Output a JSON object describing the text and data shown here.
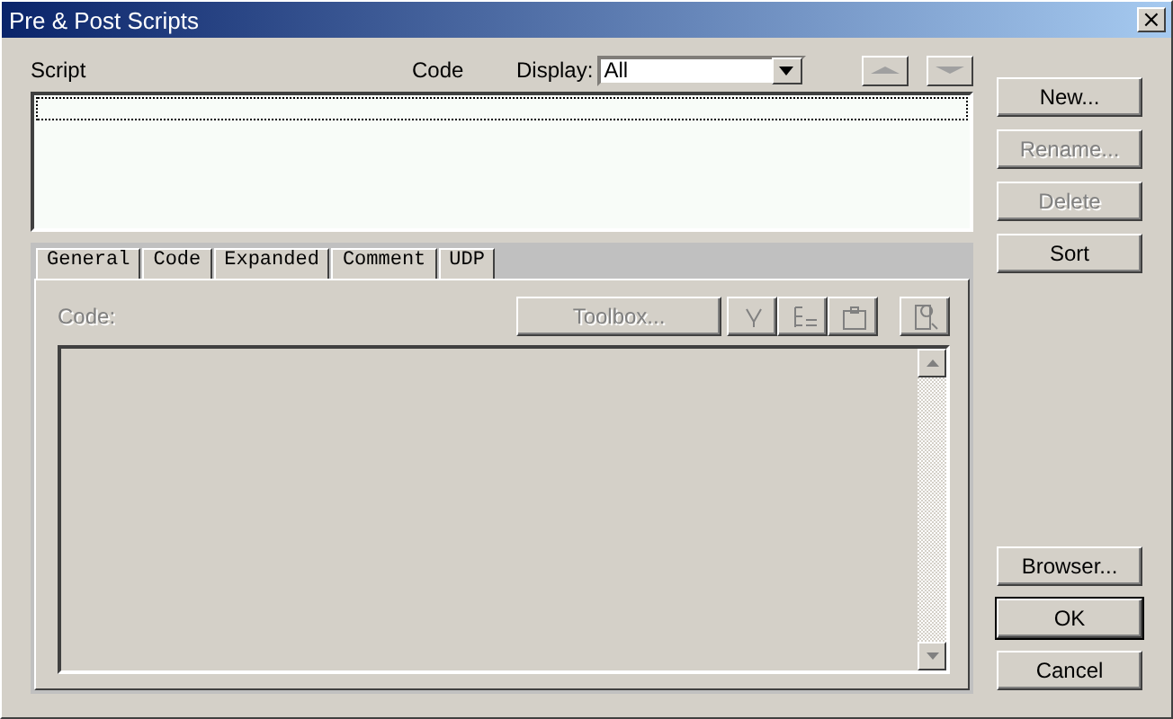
{
  "window": {
    "title": "Pre & Post Scripts",
    "close": "×"
  },
  "list_header": {
    "script": "Script",
    "code": "Code",
    "display_label": "Display:",
    "display_value": "All"
  },
  "move_buttons": [
    {
      "kind": "up",
      "disabled": true
    },
    {
      "kind": "down",
      "disabled": true
    }
  ],
  "top_buttons": [
    {
      "label": "New...",
      "disabled": false,
      "default": false
    },
    {
      "label": "Rename...",
      "disabled": true,
      "default": false
    },
    {
      "label": "Delete",
      "disabled": true,
      "default": false
    },
    {
      "label": "Sort",
      "disabled": false,
      "default": false
    }
  ],
  "bottom_buttons": [
    {
      "label": "Browser...",
      "disabled": false,
      "default": false
    },
    {
      "label": "OK",
      "disabled": false,
      "default": true
    },
    {
      "label": "Cancel",
      "disabled": false,
      "default": false
    }
  ],
  "tabs": [
    {
      "label": "General",
      "selected": false
    },
    {
      "label": "Code",
      "selected": true
    },
    {
      "label": "Expanded",
      "selected": false
    },
    {
      "label": "Comment",
      "selected": false
    },
    {
      "label": "UDP",
      "selected": false
    }
  ],
  "code_page": {
    "label": "Code:",
    "label_disabled": true,
    "toolbox": {
      "label": "Toolbox...",
      "disabled": true
    },
    "tools": [
      {
        "kind": "variable",
        "disabled": true
      },
      {
        "kind": "list",
        "disabled": true
      },
      {
        "kind": "paste",
        "disabled": true
      },
      {
        "kind": "preview",
        "disabled": true
      }
    ]
  }
}
